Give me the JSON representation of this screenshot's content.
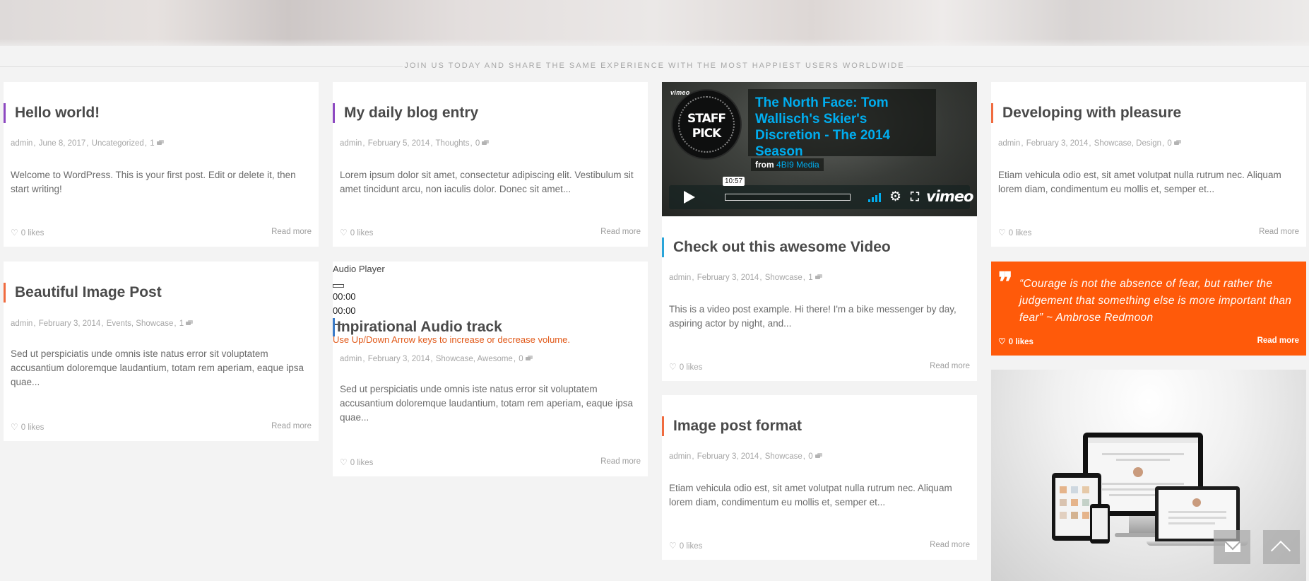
{
  "tagline": "JOIN US TODAY AND SHARE THE SAME EXPERIENCE WITH THE MOST HAPPIEST USERS WORLDWIDE",
  "posts": {
    "hello": {
      "title": "Hello world!",
      "author": "admin",
      "date": "June 8, 2017",
      "categories": "Uncategorized",
      "comments": "1",
      "excerpt": "Welcome to WordPress. This is your first post. Edit or delete it, then start writing!",
      "likes": "0 likes",
      "read_more": "Read more"
    },
    "daily": {
      "title": "My daily blog entry",
      "author": "admin",
      "date": "February 5, 2014",
      "categories": "Thoughts",
      "comments": "0",
      "excerpt": "Lorem ipsum dolor sit amet, consectetur adipiscing elit. Vestibulum sit amet tincidunt arcu, non iaculis dolor. Donec sit amet...",
      "likes": "0 likes",
      "read_more": "Read more"
    },
    "video": {
      "title": "Check out this awesome Video",
      "author": "admin",
      "date": "February 3, 2014",
      "categories": "Showcase",
      "comments": "1",
      "excerpt": "This is a video post example. Hi there! I'm a bike messenger by day, aspiring actor by night, and...",
      "likes": "0 likes",
      "read_more": "Read more"
    },
    "developing": {
      "title": "Developing with pleasure",
      "author": "admin",
      "date": "February 3, 2014",
      "categories": "Showcase, Design",
      "comments": "0",
      "excerpt": "Etiam vehicula odio est, sit amet volutpat nulla rutrum nec. Aliquam lorem diam, condimentum eu mollis et, semper et...",
      "likes": "0 likes",
      "read_more": "Read more"
    },
    "image": {
      "title": "Beautiful Image Post",
      "author": "admin",
      "date": "February 3, 2014",
      "categories": "Events, Showcase",
      "comments": "1",
      "excerpt": "Sed ut perspiciatis unde omnis iste natus error sit voluptatem accusantium doloremque laudantium, totam rem aperiam, eaque ipsa quae...",
      "likes": "0 likes",
      "read_more": "Read more"
    },
    "audio": {
      "title": "Inpirational Audio track",
      "author": "admin",
      "date": "February 3, 2014",
      "categories": "Showcase, Awesome",
      "comments": "0",
      "excerpt": "Sed ut perspiciatis unde omnis iste natus error sit voluptatem accusantium doloremque laudantium, totam rem aperiam, eaque ipsa quae...",
      "likes": "0 likes",
      "read_more": "Read more"
    },
    "image_format": {
      "title": "Image post format",
      "author": "admin",
      "date": "February 3, 2014",
      "categories": "Showcase",
      "comments": "0",
      "excerpt": "Etiam vehicula odio est, sit amet volutpat nulla rutrum nec. Aliquam lorem diam, condimentum eu mollis et, semper et...",
      "likes": "0 likes",
      "read_more": "Read more"
    }
  },
  "video_embed": {
    "vimeo_tag": "vimeo",
    "badge": "STAFF PICK",
    "title": "The North Face: Tom Wallisch's Skier's Discretion - The 2014 Season",
    "from_label": "from",
    "from_user": "4BI9 Media",
    "duration": "10:57",
    "progress": 0,
    "logo": "vimeo",
    "settings_icon": "gear-icon",
    "fullscreen_icon": "fullscreen-icon",
    "accent": "#00adef"
  },
  "audio_player": {
    "label": "Audio Player",
    "current_time": "00:00",
    "duration": "00:00",
    "hint": "Use Up/Down Arrow keys to increase or decrease volume."
  },
  "quote": {
    "text": "“Courage is not the absence of fear, but rather the judgement that something else is more important than fear” ~ Ambrose Redmoon",
    "likes": "0 likes",
    "read_more": "Read more",
    "accent": "#ff5a0a"
  },
  "float_buttons": {
    "mail_icon": "envelope-icon",
    "top_icon": "chevron-up-icon"
  }
}
